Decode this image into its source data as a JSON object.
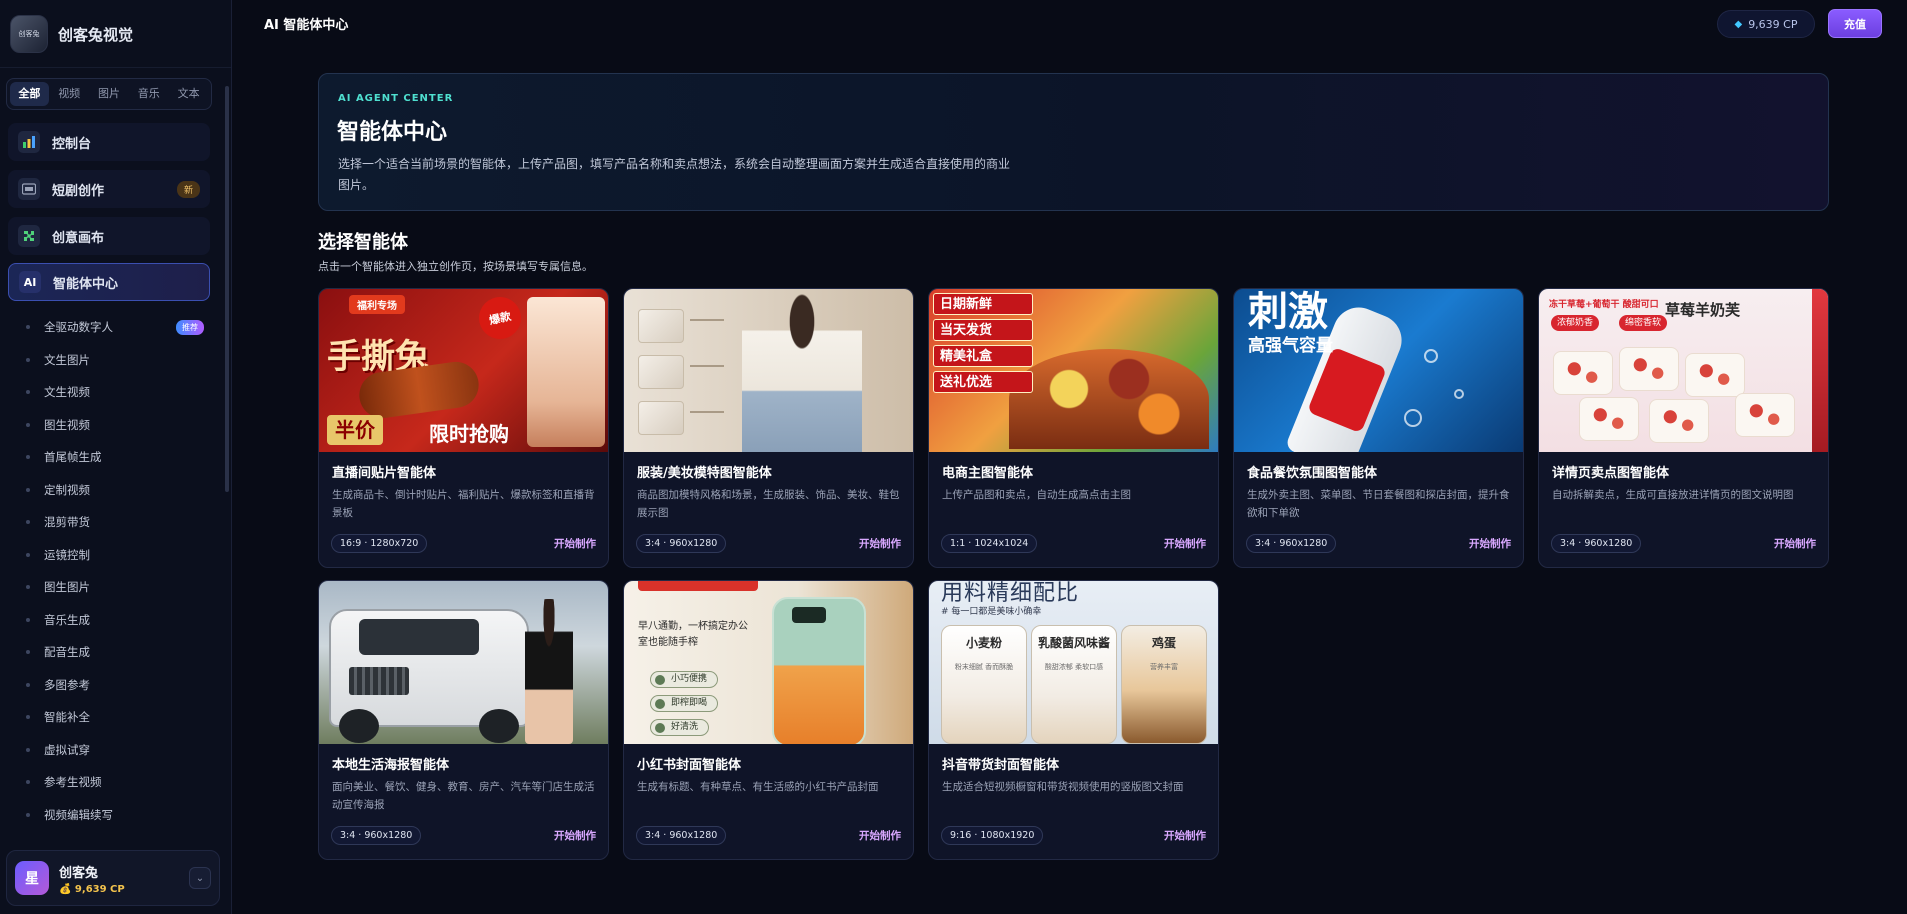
{
  "brand": {
    "name": "创客兔视觉",
    "logo_text": "创客兔"
  },
  "sidebar": {
    "filter_tabs": [
      "全部",
      "视频",
      "图片",
      "音乐",
      "文本"
    ],
    "nav": [
      {
        "label": "控制台",
        "icon": "dashboard-icon"
      },
      {
        "label": "短剧创作",
        "icon": "film-icon",
        "badge": "新"
      },
      {
        "label": "创意画布",
        "icon": "puzzle-icon"
      },
      {
        "label": "智能体中心",
        "icon": "ai-icon",
        "icon_text": "AI"
      }
    ],
    "sub_items": [
      {
        "label": "全驱动数字人",
        "badge": "推荐"
      },
      {
        "label": "文生图片"
      },
      {
        "label": "文生视频"
      },
      {
        "label": "图生视频"
      },
      {
        "label": "首尾帧生成"
      },
      {
        "label": "定制视频"
      },
      {
        "label": "混剪带货"
      },
      {
        "label": "运镜控制"
      },
      {
        "label": "图生图片"
      },
      {
        "label": "音乐生成"
      },
      {
        "label": "配音生成"
      },
      {
        "label": "多图参考"
      },
      {
        "label": "智能补全"
      },
      {
        "label": "虚拟试穿"
      },
      {
        "label": "参考生视频"
      },
      {
        "label": "视频编辑续写"
      }
    ],
    "user": {
      "avatar": "星",
      "name": "创客兔",
      "credits": "💰 9,639 CP"
    }
  },
  "topbar": {
    "title": "AI 智能体中心",
    "credits": "9,639 CP",
    "recharge": "充值"
  },
  "hero": {
    "eyebrow": "AI AGENT CENTER",
    "title": "智能体中心",
    "description": "选择一个适合当前场景的智能体，上传产品图，填写产品名称和卖点想法，系统会自动整理画面方案并生成适合直接使用的商业图片。"
  },
  "section": {
    "title": "选择智能体",
    "subtitle": "点击一个智能体进入独立创作页，按场景填写专属信息。"
  },
  "cta_label": "开始制作",
  "cards": [
    {
      "title": "直播间贴片智能体",
      "desc": "生成商品卡、倒计时贴片、福利贴片、爆款标签和直播背景板",
      "spec": "16:9 · 1280x720",
      "art": {
        "tag": "福利专场",
        "big": "手撕兔",
        "burst": "爆款",
        "price": "半价",
        "limit": "限时抢购"
      }
    },
    {
      "title": "服装/美妆模特图智能体",
      "desc": "商品图加模特风格和场景，生成服装、饰品、美妆、鞋包展示图",
      "spec": "3:4 · 960x1280",
      "art": {}
    },
    {
      "title": "电商主图智能体",
      "desc": "上传产品图和卖点，自动生成高点击主图",
      "spec": "1:1 · 1024x1024",
      "art": {
        "stamps": [
          "日期新鲜",
          "当天发货",
          "精美礼盒",
          "送礼优选"
        ]
      }
    },
    {
      "title": "食品餐饮氛围图智能体",
      "desc": "生成外卖主图、菜单图、节日套餐图和探店封面，提升食欲和下单欲",
      "spec": "3:4 · 960x1280",
      "art": {
        "big": "刺激",
        "cap": "高强气容量"
      }
    },
    {
      "title": "详情页卖点图智能体",
      "desc": "自动拆解卖点，生成可直接放进详情页的图文说明图",
      "spec": "3:4 · 960x1280",
      "art": {
        "top": "冻干草莓+葡萄干 酸甜可口",
        "head": "草莓羊奶芙",
        "chips": [
          "浓郁奶香",
          "绵密香软"
        ]
      }
    },
    {
      "title": "本地生活海报智能体",
      "desc": "面向美业、餐饮、健身、教育、房产、汽车等门店生成活动宣传海报",
      "spec": "3:4 · 960x1280",
      "art": {}
    },
    {
      "title": "小红书封面智能体",
      "desc": "生成有标题、有种草点、有生活感的小红书产品封面",
      "spec": "3:4 · 960x1280",
      "art": {
        "text": "早八通勤，一杯搞定办公室也能随手榨",
        "pills": [
          "小巧便携",
          "即榨即喝",
          "好清洗"
        ]
      }
    },
    {
      "title": "抖音带货封面智能体",
      "desc": "生成适合短视频橱窗和带货视频使用的竖版图文封面",
      "spec": "9:16 · 1080x1920",
      "art": {
        "headline": "用料精细配比",
        "sub": "# 每一口都是美味小确幸",
        "panels": [
          {
            "t": "小麦粉",
            "s": "粉末细腻 香而酥脆"
          },
          {
            "t": "乳酸菌风味酱",
            "s": "酸甜浓郁 柔软口感"
          },
          {
            "t": "鸡蛋",
            "s": "营养丰富"
          }
        ]
      }
    }
  ],
  "colors": {
    "accent": "#8a5cff",
    "active_nav": "#3b4fb0",
    "eyebrow": "#4fe0d0",
    "cta": "#d9a8ff"
  }
}
